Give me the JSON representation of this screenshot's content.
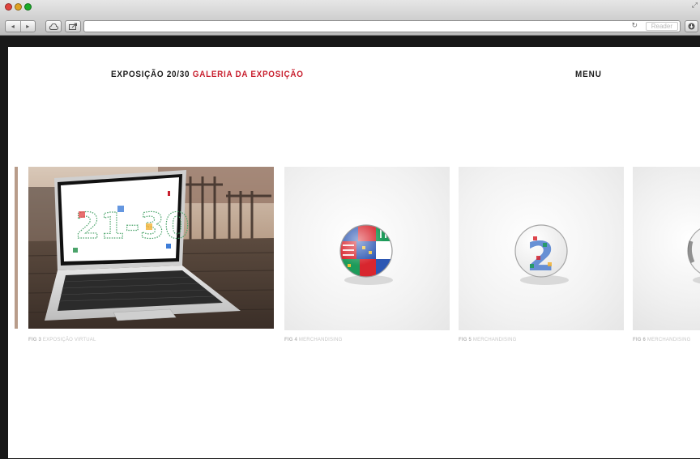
{
  "browser": {
    "reader_label": "Reader"
  },
  "header": {
    "brand": "EXPOSIÇÃO 20/30",
    "section": "GALERIA DA EXPOSIÇÃO",
    "menu_label": "MENU"
  },
  "gallery": [
    {
      "fig": "FIG 3",
      "label": "EXPOSIÇÃO VIRTUAL",
      "screen_text": "21-30"
    },
    {
      "fig": "FIG 4",
      "label": "MERCHANDISING"
    },
    {
      "fig": "FIG 5",
      "label": "MERCHANDISING",
      "badge_text": "2"
    },
    {
      "fig": "FIG 6",
      "label": "MERCHANDISING"
    }
  ],
  "colors": {
    "accent_red": "#c8202f",
    "text_dark": "#1a1a1a",
    "caption_grey": "#c7c7c7"
  }
}
